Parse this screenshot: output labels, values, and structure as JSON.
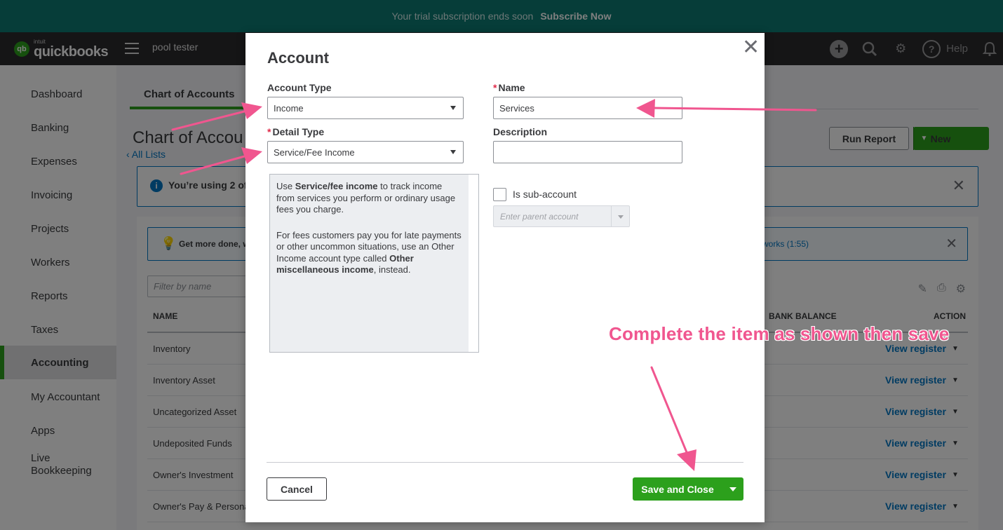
{
  "trial_bar": {
    "message": "Your trial subscription ends soon",
    "action": "Subscribe Now"
  },
  "topnav": {
    "logo_small": "intuit",
    "logo": "quickbooks",
    "company": "pool tester",
    "icons": [
      "plus-icon",
      "search-icon",
      "gear-icon",
      "help-icon",
      "bell-icon"
    ],
    "help": "Help"
  },
  "sidebar": {
    "items": [
      {
        "label": "Dashboard"
      },
      {
        "label": "Banking"
      },
      {
        "label": "Expenses"
      },
      {
        "label": "Invoicing"
      },
      {
        "label": "Projects"
      },
      {
        "label": "Workers"
      },
      {
        "label": "Reports"
      },
      {
        "label": "Taxes"
      },
      {
        "label": "Accounting",
        "active": true
      },
      {
        "label": "My Accountant"
      },
      {
        "label": "Apps"
      },
      {
        "label": "Live Bookkeeping"
      }
    ]
  },
  "main": {
    "tab": "Chart of Accounts",
    "page_title": "Chart of Accou",
    "all_lists": "All Lists",
    "run_report": "Run Report",
    "new_button": "New",
    "info_banner": "You’re using 2 of",
    "tip_banner": "Get more done, w",
    "tip_link": "works (1:55)",
    "filter_placeholder": "Filter by name",
    "columns": {
      "name": "NAME",
      "bank_balance": "BANK BALANCE",
      "action": "ACTION"
    },
    "rows": [
      {
        "name": "Inventory",
        "action": "View register"
      },
      {
        "name": "Inventory Asset",
        "action": "View register"
      },
      {
        "name": "Uncategorized Asset",
        "action": "View register"
      },
      {
        "name": "Undeposited Funds",
        "action": "View register"
      },
      {
        "name": "Owner's Investment",
        "action": "View register"
      },
      {
        "name": "Owner's Pay & Persona",
        "action": "View register"
      }
    ]
  },
  "modal": {
    "title": "Account",
    "account_type_label": "Account Type",
    "account_type_value": "Income",
    "detail_type_label": "Detail Type",
    "detail_type_value": "Service/Fee Income",
    "name_label": "Name",
    "name_value": "Services",
    "description_label": "Description",
    "description_value": "",
    "help_p1_a": "Use ",
    "help_p1_b": "Service/fee income",
    "help_p1_c": " to track income from services you perform or ordinary usage fees you charge.",
    "help_p2_a": "For fees customers pay you for late payments or other uncommon situations, use an Other Income account type called ",
    "help_p2_b": "Other miscellaneous income",
    "help_p2_c": ", instead.",
    "sub_account_label": "Is sub-account",
    "parent_placeholder": "Enter parent account",
    "cancel": "Cancel",
    "save": "Save and Close"
  },
  "annotation": {
    "text": "Complete the item as shown then save",
    "color": "#f0568f"
  },
  "colors": {
    "brand_green": "#2ca01c",
    "trial_bar": "#0d7a72",
    "link_blue": "#0077c5",
    "topnav": "#2a2a2d"
  }
}
